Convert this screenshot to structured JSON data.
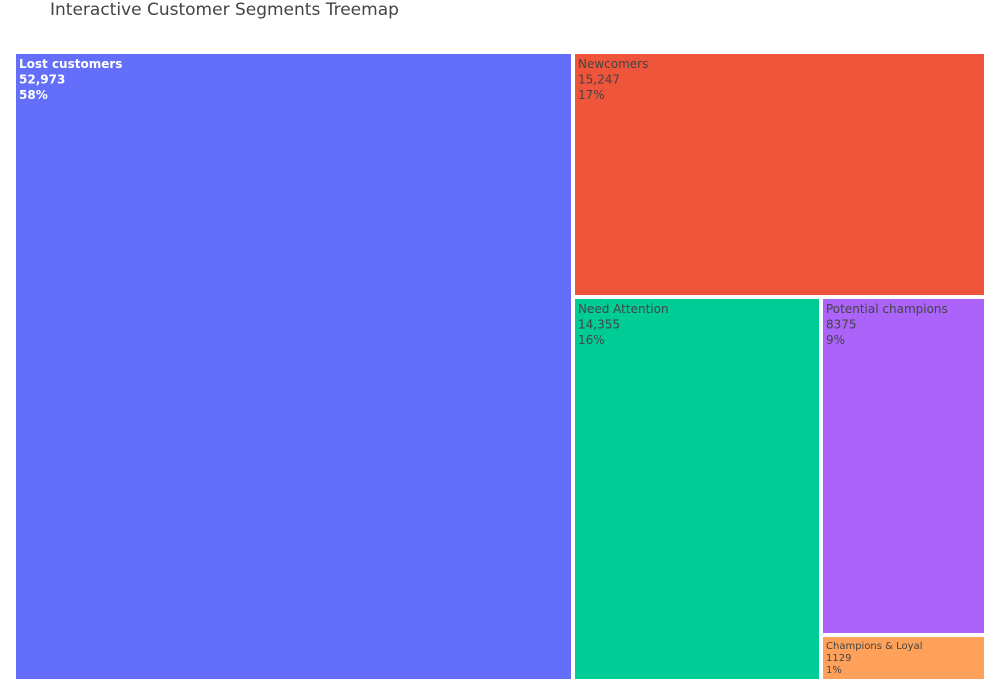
{
  "title": "Interactive Customer Segments Treemap",
  "chart_data": {
    "type": "treemap",
    "title": "Interactive Customer Segments Treemap",
    "items": [
      {
        "label": "Lost customers",
        "value": 52973,
        "value_text": "52,973",
        "percent_text": "58%",
        "color": "#636efa",
        "text_color": "#ffffff",
        "bold": true
      },
      {
        "label": "Newcomers",
        "value": 15247,
        "value_text": "15,247",
        "percent_text": "17%",
        "color": "#ef553b",
        "text_color": "#444444",
        "bold": false
      },
      {
        "label": "Need Attention",
        "value": 14355,
        "value_text": "14,355",
        "percent_text": "16%",
        "color": "#00cc96",
        "text_color": "#444444",
        "bold": false
      },
      {
        "label": "Potential champions",
        "value": 8375,
        "value_text": "8375",
        "percent_text": "9%",
        "color": "#ab63fa",
        "text_color": "#444444",
        "bold": false
      },
      {
        "label": "Champions & Loyal",
        "value": 1129,
        "value_text": "1129",
        "percent_text": "1%",
        "color": "#ffa15a",
        "text_color": "#444444",
        "bold": false
      }
    ]
  }
}
